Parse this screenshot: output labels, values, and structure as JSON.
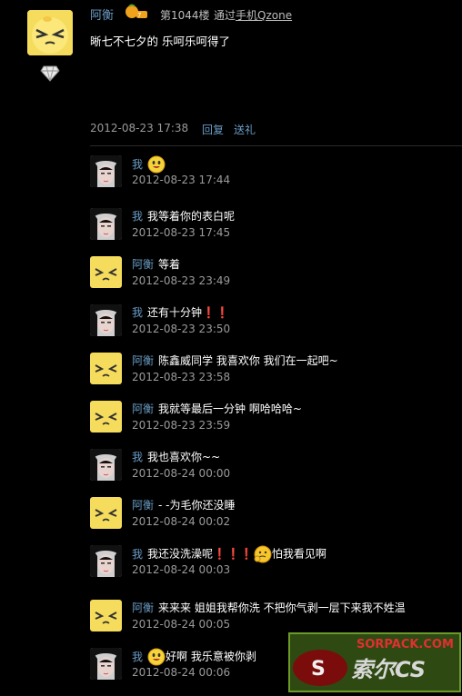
{
  "post": {
    "author": "阿衡",
    "floor": "第1044楼",
    "via_prefix": "通过",
    "via_link": "手机Qzone",
    "content": "晰七不七夕的 乐呵乐呵得了",
    "time": "2012-08-23 17:38",
    "reply_label": "回复",
    "gift_label": "送礼"
  },
  "replies": [
    {
      "author": "我",
      "text": "",
      "time": "2012-08-23 17:44",
      "avatar": "me",
      "emoji_after": "smile-emoji"
    },
    {
      "author": "我",
      "text": "我等着你的表白呢",
      "time": "2012-08-23 17:45",
      "avatar": "me"
    },
    {
      "author": "阿衡",
      "text": "等着",
      "time": "2012-08-23 23:49",
      "avatar": "heng"
    },
    {
      "author": "我",
      "text": "还有十分钟❗❗",
      "time": "2012-08-23 23:50",
      "avatar": "me"
    },
    {
      "author": "阿衡",
      "text": "陈鑫威同学 我喜欢你 我们在一起吧~",
      "time": "2012-08-23 23:58",
      "avatar": "heng"
    },
    {
      "author": "阿衡",
      "text": "我就等最后一分钟 啊哈哈哈~",
      "time": "2012-08-23 23:59",
      "avatar": "heng"
    },
    {
      "author": "我",
      "text": "我也喜欢你~~",
      "time": "2012-08-24 00:00",
      "avatar": "me"
    },
    {
      "author": "阿衡",
      "text": "- -为毛你还没睡",
      "time": "2012-08-24 00:02",
      "avatar": "heng"
    },
    {
      "author": "我",
      "text": "我还没洗澡呢❗❗❗",
      "text_after": "怕我看见啊",
      "time": "2012-08-24 00:03",
      "avatar": "me",
      "emoji_after": "think-emoji"
    },
    {
      "author": "阿衡",
      "text": "来来来 姐姐我帮你洗 不把你气剥一层下来我不姓温",
      "time": "2012-08-24 00:05",
      "avatar": "heng"
    },
    {
      "author": "我",
      "text": "",
      "text_after": "好啊 我乐意被你剥",
      "time": "2012-08-24 00:06",
      "avatar": "me",
      "emoji_after": "smile-emoji"
    }
  ],
  "watermark": {
    "line1": "SORPACK.COM",
    "line2": "索尔CS"
  },
  "colors": {
    "background": "#000000",
    "name": "#6a9bc4",
    "text": "#ffffff",
    "meta": "#9a9a9a"
  }
}
